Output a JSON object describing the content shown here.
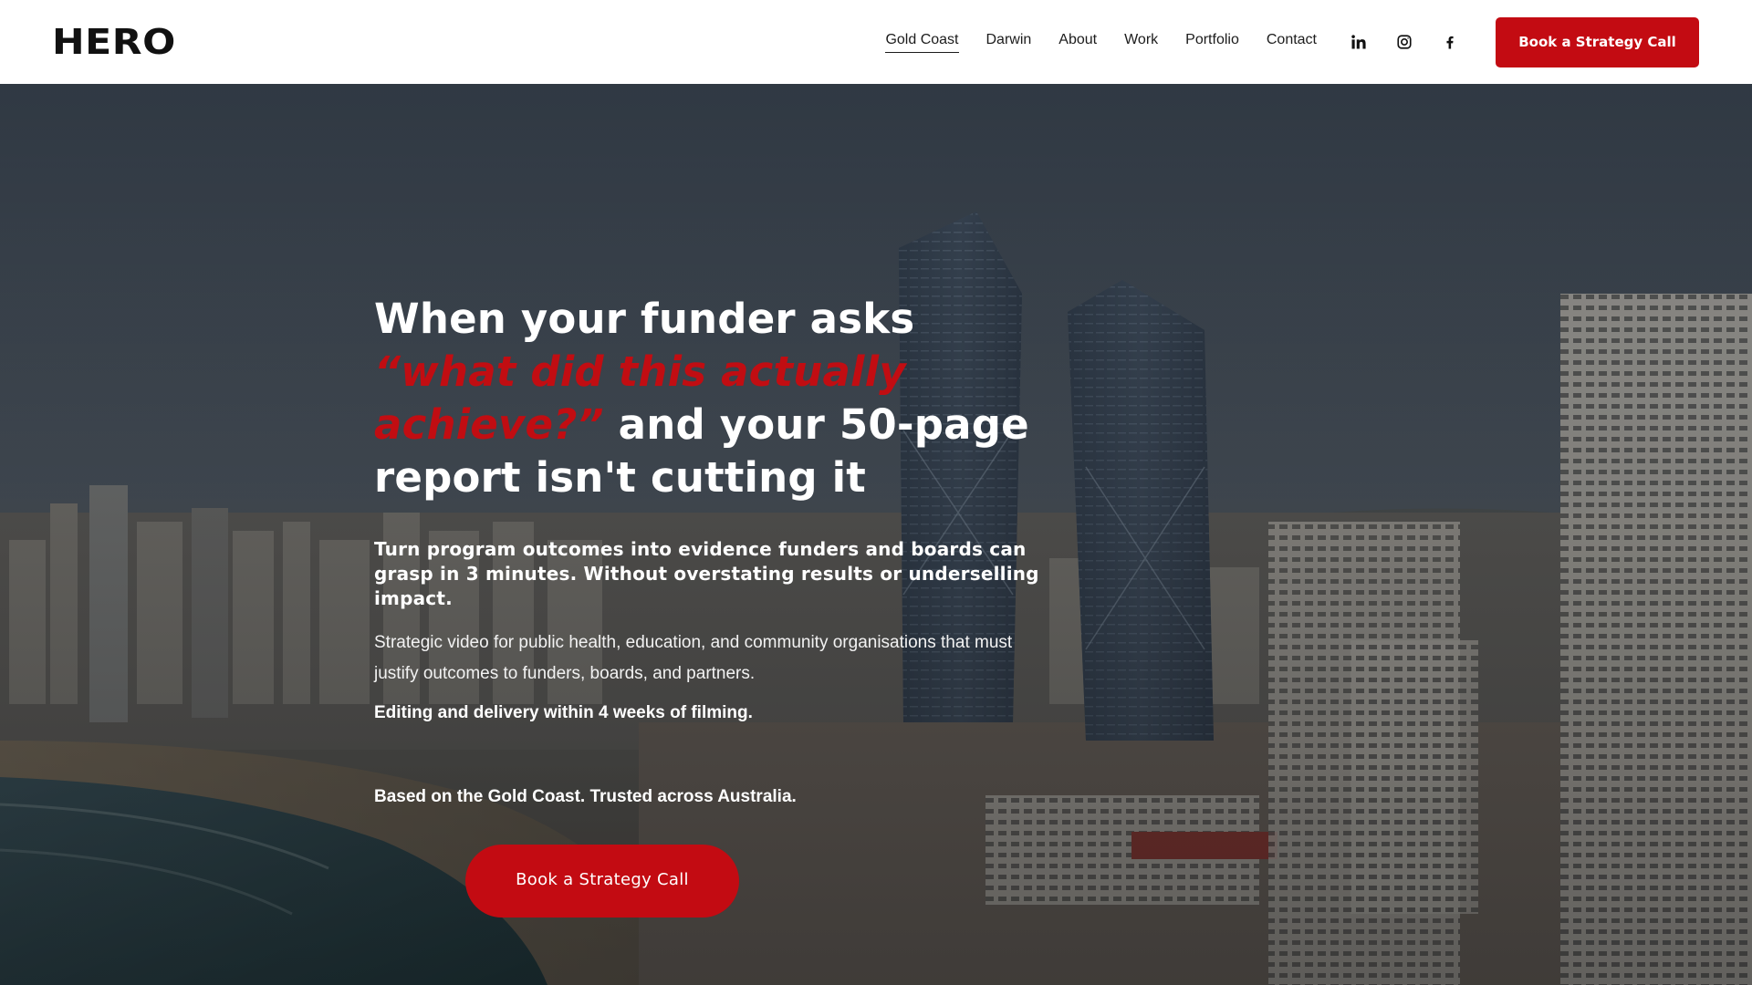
{
  "header": {
    "logo": "HERO",
    "nav": [
      {
        "label": "Gold Coast",
        "active": true
      },
      {
        "label": "Darwin",
        "active": false
      },
      {
        "label": "About",
        "active": false
      },
      {
        "label": "Work",
        "active": false
      },
      {
        "label": "Portfolio",
        "active": false
      },
      {
        "label": "Contact",
        "active": false
      }
    ],
    "socials": [
      "linkedin-icon",
      "instagram-icon",
      "facebook-icon"
    ],
    "cta_label": "Book a Strategy Call"
  },
  "hero": {
    "headline_part1": "When your funder asks",
    "headline_accent": "“what did this actually achieve?”",
    "headline_part2": "and your 50-page report isn't cutting it",
    "subhead": "Turn program outcomes into evidence funders and boards can grasp in 3 minutes. Without overstating results or underselling impact.",
    "body": "Strategic video for public health, education, and community organisations that must justify outcomes to funders, boards, and partners.",
    "body_bold": "Editing and delivery within 4 weeks of filming.",
    "location": "Based on the Gold Coast. Trusted across Australia.",
    "cta_label": "Book a Strategy Call"
  },
  "colors": {
    "accent": "#c30b12",
    "header_bg": "#ffffff",
    "text_on_hero": "#ffffff"
  }
}
